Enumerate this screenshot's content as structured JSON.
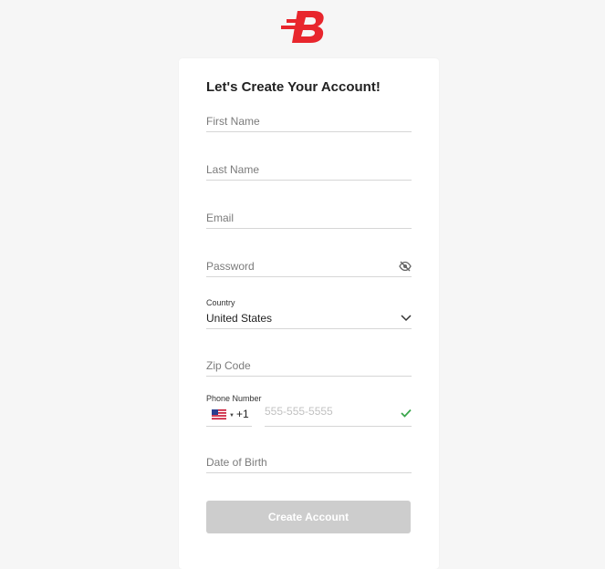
{
  "brand": {
    "color": "#e8262d"
  },
  "form": {
    "title": "Let's Create Your Account!",
    "first_name_placeholder": "First Name",
    "last_name_placeholder": "Last Name",
    "email_placeholder": "Email",
    "password_placeholder": "Password",
    "country_label": "Country",
    "country_value": "United States",
    "zip_placeholder": "Zip Code",
    "phone_label": "Phone Number",
    "phone_dial_code": "+1",
    "phone_placeholder": "555-555-5555",
    "dob_placeholder": "Date of Birth",
    "submit_label": "Create Account"
  },
  "icons": {
    "logo": "bovada-b-logo",
    "password_toggle": "eye-slash-icon",
    "country_dropdown": "chevron-down-icon",
    "country_flag": "us-flag-icon",
    "phone_valid": "check-icon"
  },
  "colors": {
    "accent": "#e8262d",
    "valid": "#3aa64c",
    "button_disabled": "#cdcdcd"
  }
}
